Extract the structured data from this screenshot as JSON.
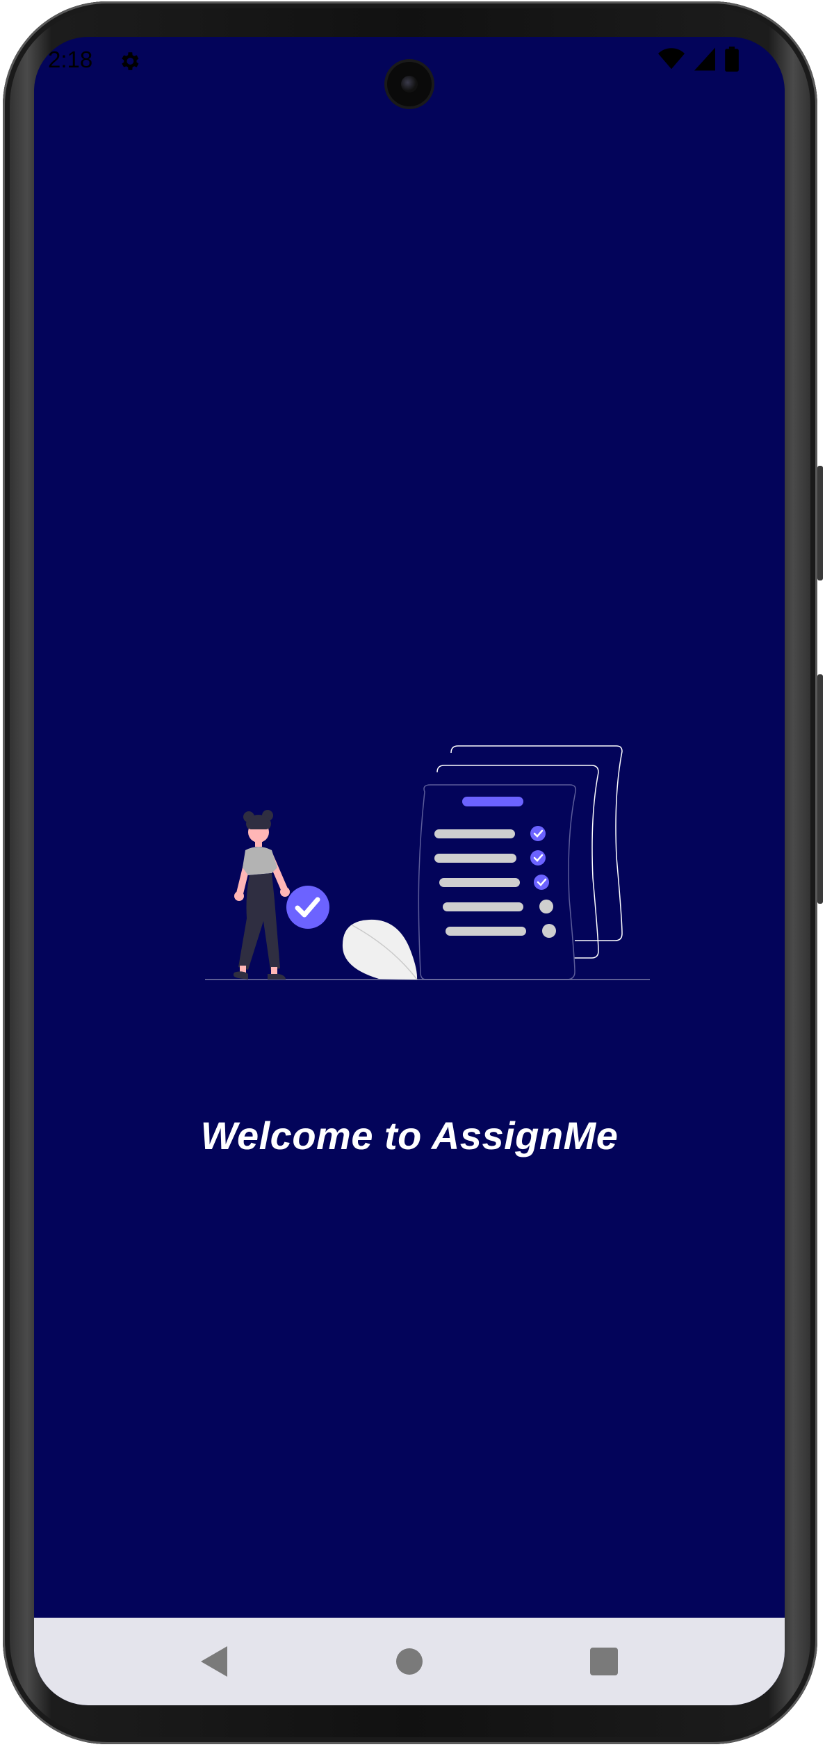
{
  "status_bar": {
    "time": "2:18",
    "settings_icon": "gear-icon",
    "wifi_icon": "wifi-icon",
    "signal_icon": "cellular-signal-icon",
    "battery_icon": "battery-icon"
  },
  "splash": {
    "illustration": "task-checklist-illustration",
    "welcome_text": "Welcome to AssignMe"
  },
  "nav_bar": {
    "back_icon": "back-triangle-icon",
    "home_icon": "home-circle-icon",
    "recents_icon": "recents-square-icon"
  },
  "colors": {
    "background": "#03045a",
    "accent": "#6c63ff",
    "nav_bar": "#e4e4ec",
    "text": "#ffffff"
  }
}
